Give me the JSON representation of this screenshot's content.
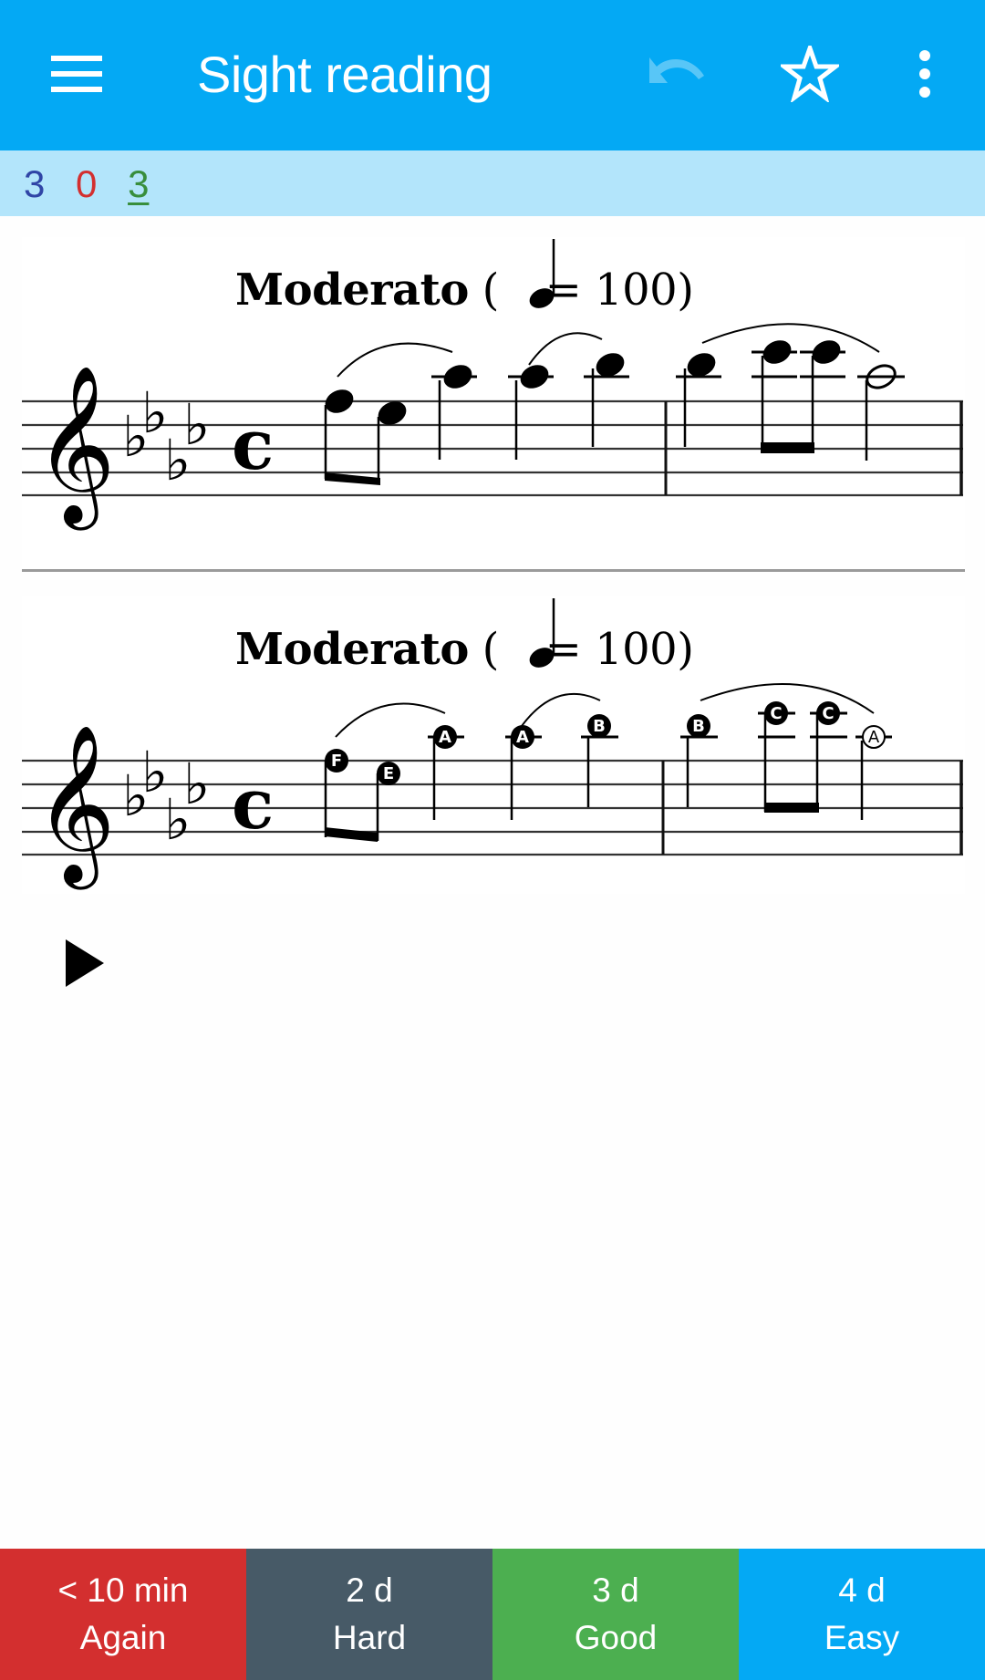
{
  "app_bar": {
    "title": "Sight reading",
    "icons": [
      "menu-icon",
      "undo-icon",
      "star-outline-icon",
      "more-vert-icon"
    ],
    "colors": {
      "background": "#04a9f4",
      "undo_disabled": "#58c6f7"
    }
  },
  "counts": {
    "new": "3",
    "learning": "0",
    "review": "3",
    "colors": {
      "new": "#3045a6",
      "learning": "#d32f2f",
      "review": "#388e3c"
    }
  },
  "question": {
    "tempo_label": "Moderato",
    "tempo_open": "(",
    "tempo_equals": "= 100)",
    "tempo_bpm": 100,
    "clef": "treble",
    "key_signature": "4 flats (A♭ major)",
    "time_signature": "C",
    "measures": [
      {
        "notes": [
          "F eighth",
          "E eighth",
          "A quarter",
          "A quarter",
          "B quarter"
        ]
      },
      {
        "notes": [
          "B quarter",
          "C eighth",
          "C eighth",
          "A half"
        ]
      }
    ]
  },
  "answer": {
    "tempo_label": "Moderato",
    "tempo_open": "(",
    "tempo_equals": "= 100)",
    "note_labels": [
      "F",
      "E",
      "A",
      "A",
      "B",
      "B",
      "C",
      "C",
      "A"
    ]
  },
  "play_button": {
    "icon": "play-icon"
  },
  "answer_buttons": [
    {
      "interval": "< 10 min",
      "label": "Again",
      "color": "#d32f2f"
    },
    {
      "interval": "2 d",
      "label": "Hard",
      "color": "#475a67"
    },
    {
      "interval": "3 d",
      "label": "Good",
      "color": "#4caf50"
    },
    {
      "interval": "4 d",
      "label": "Easy",
      "color": "#04a9f4"
    }
  ]
}
